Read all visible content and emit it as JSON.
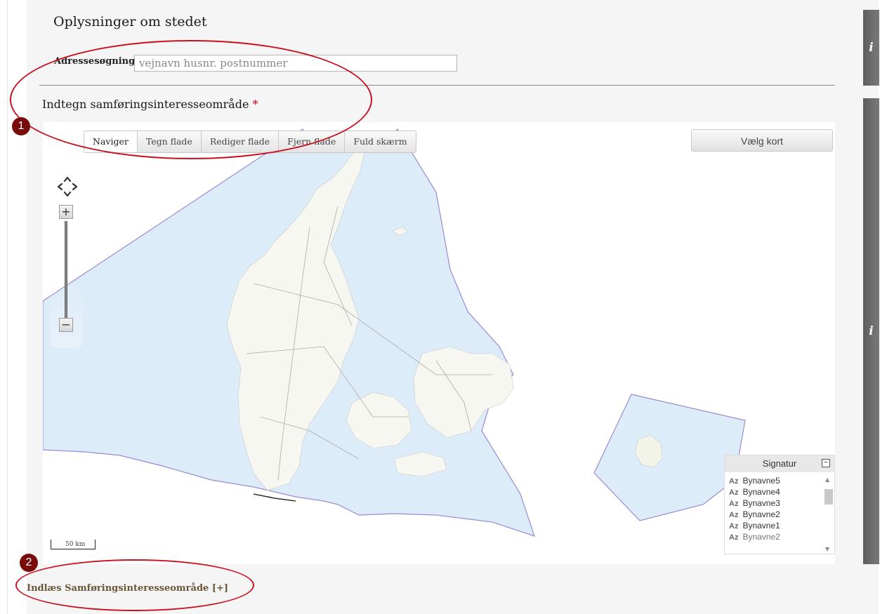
{
  "section": {
    "title": "Oplysninger om stedet"
  },
  "address_search": {
    "label": "Adressesøgning",
    "placeholder": "vejnavn husnr. postnummer",
    "value": ""
  },
  "draw": {
    "title": "Indtegn samføringsinteresseområde",
    "required_marker": "*"
  },
  "toolbar": {
    "buttons": [
      {
        "label": "Naviger",
        "active": true
      },
      {
        "label": "Tegn flade",
        "active": false
      },
      {
        "label": "Rediger flade",
        "active": false
      },
      {
        "label": "Fjern flade",
        "active": false
      },
      {
        "label": "Fuld skærm",
        "active": false
      }
    ],
    "choose_map_label": "Vælg kort"
  },
  "map_controls": {
    "zoom_in": "+",
    "zoom_out": "−",
    "pan_icon": "pan-arrows-icon"
  },
  "scale": {
    "label": "50 km"
  },
  "legend": {
    "title": "Signatur",
    "toggle": "−",
    "items": [
      {
        "symbol": "Az",
        "label": "Bynavne5"
      },
      {
        "symbol": "Az",
        "label": "Bynavne4"
      },
      {
        "symbol": "Az",
        "label": "Bynavne3"
      },
      {
        "symbol": "Az",
        "label": "Bynavne2"
      },
      {
        "symbol": "Az",
        "label": "Bynavne1"
      },
      {
        "symbol": "Az",
        "label": "Bynavne2"
      }
    ]
  },
  "upload": {
    "label": "Indlæs Samføringsinteresseområde [+]"
  },
  "side_tabs": [
    {
      "label": "i"
    },
    {
      "label": "i"
    }
  ],
  "callouts": [
    {
      "number": "1"
    },
    {
      "number": "2"
    }
  ],
  "colors": {
    "sea": "#dcecf8",
    "boundary": "#9a8bd6",
    "land": "#f7f7f2",
    "callout_ring": "#c8101e",
    "callout_badge": "#7a0b0b",
    "link": "#6a5638"
  }
}
